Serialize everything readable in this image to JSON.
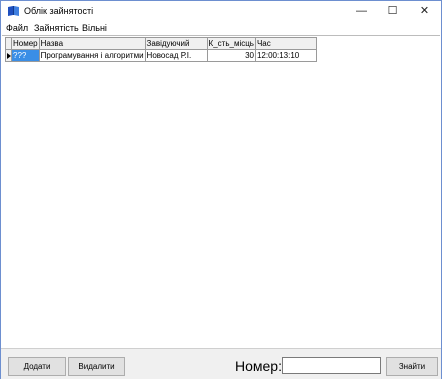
{
  "window": {
    "title": "Облік зайнятості",
    "controls": {
      "minimize": "—",
      "maximize": "☐",
      "close": "✕"
    }
  },
  "menu": [
    "Файл",
    "Зайнятість",
    "Вільні"
  ],
  "grid": {
    "columns": [
      "Номер",
      "Назва",
      "Завідуючий",
      "К_сть_місць",
      "Час"
    ],
    "rows": [
      [
        "???",
        "Програмування і алгоритми",
        "Новосад Р.І.",
        "30",
        "12:00:13:10"
      ]
    ]
  },
  "bottom": {
    "add_label": "Додати",
    "delete_label": "Видалити",
    "number_label": "Номер:",
    "number_value": "",
    "find_label": "Знайти"
  }
}
